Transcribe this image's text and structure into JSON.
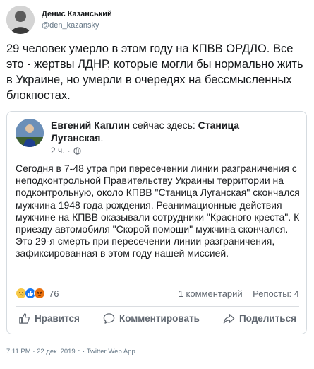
{
  "author": {
    "name": "Денис Казанський",
    "handle": "@den_kazansky"
  },
  "tweet_text": "29 человек умерло в этом году на КПВВ ОРДЛО. Все это - жертвы ЛДНР, которые могли бы нормально жить в Украине, но умерли в очередях на бессмысленных блокпостах.",
  "embed": {
    "author_name": "Евгений Каплин",
    "title_middle": " сейчас здесь: ",
    "location": "Станица Луганская",
    "title_end": ".",
    "time": "2 ч.",
    "body": "Сегодня в 7-48 утра при пересечении линии разграничения с неподконтрольной Правительству Украины территории на подконтрольную, около КПВВ \"Станица Луганская\" скончался мужчина 1948 года рождения. Реанимационные действия мужчине на КПВВ оказывали сотрудники \"Красного креста\". К приезду автомобиля \"Скорой помощи\" мужчина скончался.\nЭто 29-я смерть при пересечении линии разграничения, зафиксированная в этом году нашей миссией.",
    "reactions_count": "76",
    "comments": "1 комментарий",
    "shares": "Репосты: 4",
    "actions": {
      "like": "Нравится",
      "comment": "Комментировать",
      "share": "Поделиться"
    }
  },
  "timestamp": "7:11 PM · 22 дек. 2019 г. · Twitter Web App",
  "colors": {
    "text": "#14171a",
    "muted": "#657786",
    "fb_text": "#1c1e21",
    "fb_muted": "#606770",
    "border": "#d5dbe0"
  }
}
